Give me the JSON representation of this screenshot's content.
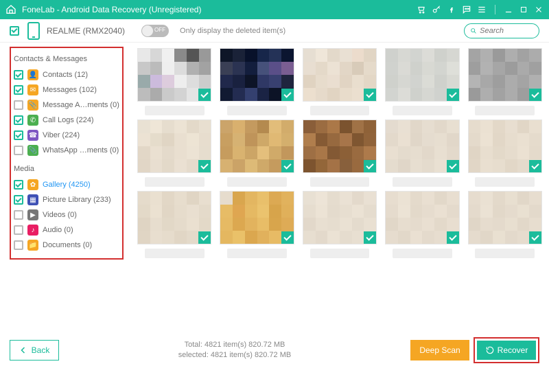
{
  "titlebar": {
    "title": "FoneLab - Android Data Recovery (Unregistered)"
  },
  "toolbar": {
    "device": "REALME (RMX2040)",
    "toggle": "OFF",
    "only_deleted": "Only display the deleted item(s)",
    "search_placeholder": "Search"
  },
  "sidebar": {
    "group1": "Contacts & Messages",
    "group2": "Media",
    "items": [
      {
        "label": "Contacts (12)",
        "checked": true,
        "color": "#f5a623",
        "glyph": "👤"
      },
      {
        "label": "Messages (102)",
        "checked": true,
        "color": "#f5a623",
        "glyph": "✉"
      },
      {
        "label": "Message A…ments (0)",
        "checked": false,
        "color": "#f5a623",
        "glyph": "📎"
      },
      {
        "label": "Call Logs (224)",
        "checked": true,
        "color": "#4caf50",
        "glyph": "✆"
      },
      {
        "label": "Viber (224)",
        "checked": true,
        "color": "#7e57c2",
        "glyph": "☎"
      },
      {
        "label": "WhatsApp …ments (0)",
        "checked": false,
        "color": "#4caf50",
        "glyph": "📎"
      },
      {
        "label": "Gallery (4250)",
        "checked": true,
        "color": "#f5a623",
        "glyph": "✿",
        "selected": true
      },
      {
        "label": "Picture Library (233)",
        "checked": true,
        "color": "#3f51b5",
        "glyph": "▦"
      },
      {
        "label": "Videos (0)",
        "checked": false,
        "color": "#777",
        "glyph": "▶"
      },
      {
        "label": "Audio (0)",
        "checked": false,
        "color": "#e91e63",
        "glyph": "♪"
      },
      {
        "label": "Documents (0)",
        "checked": false,
        "color": "#f5a623",
        "glyph": "📁"
      }
    ]
  },
  "thumbs": {
    "rows": 3,
    "cols": 5,
    "patterns": [
      [
        "#e8e8e8",
        "#d7d7d7",
        "#f0f0f0",
        "#8a8a8a",
        "#555",
        "#999",
        "#c8c8c8",
        "#bbb",
        "#efefef",
        "#dcdcdc",
        "#b0b0b0",
        "#a2a2a2",
        "#9aa",
        "#cbd",
        "#dcd",
        "#eee",
        "#ddd",
        "#ccc",
        "#bcbcbc",
        "#ababab",
        "#cacaca",
        "#d3d3d3",
        "#e4e4e4",
        "#d1d1d1"
      ],
      [
        "#0e1628",
        "#1a2238",
        "#08112a",
        "#17264a",
        "#243257",
        "#0b1530",
        "#3a3f55",
        "#2b3352",
        "#131e3d",
        "#46517a",
        "#5a4f88",
        "#7a5e92",
        "#20284b",
        "#19213f",
        "#0d1427",
        "#2f3865",
        "#384070",
        "#1f253e",
        "#111a32",
        "#232c51",
        "#34406f",
        "#1a2344",
        "#0c1326",
        "#151d36"
      ],
      [
        "#e6ded2",
        "#efe6d9",
        "#e3d9ca",
        "#e9e0d3",
        "#ecdccc",
        "#e1d5c4",
        "#e8ded1",
        "#e4d9c9",
        "#ece2d4",
        "#e2d6c6",
        "#d8cbb9",
        "#e5daca",
        "#e0d3c1",
        "#e7dccc",
        "#eaded0",
        "#e1d4c3",
        "#e9dece",
        "#e3d7c6",
        "#ecdfce",
        "#e6daca",
        "#e1d4c2",
        "#e8dccb",
        "#ebdfcf",
        "#e4d8c7"
      ],
      [
        "#cfd1cd",
        "#d7d8d3",
        "#d2d4d0",
        "#dcdcd7",
        "#cfd1cc",
        "#d6d7d2",
        "#d0d2ce",
        "#dadad5",
        "#cfd1cc",
        "#d8d9d3",
        "#d3d5d0",
        "#dedfd9",
        "#cfd1cc",
        "#d6d7d2",
        "#d1d3cf",
        "#dbdcD6",
        "#cfd1cc",
        "#d8d9d3",
        "#d2d4d0",
        "#dcdcd7",
        "#cfd1cc",
        "#d6d7d2",
        "#d0d2ce",
        "#dadad5"
      ],
      [
        "#a4a4a4",
        "#b0b0b0",
        "#9a9a9a",
        "#aeaeae",
        "#a2a2a2",
        "#acacac",
        "#9e9e9e",
        "#b2b2b2",
        "#a6a6a6",
        "#9c9c9c",
        "#aaaaaa",
        "#a0a0a0",
        "#b4b4b4",
        "#a8a8a8",
        "#9e9e9e",
        "#acacac",
        "#a4a4a4",
        "#b0b0b0",
        "#9a9a9a",
        "#aeaeae",
        "#a2a2a2",
        "#acacac",
        "#9e9e9e",
        "#b2b2b2"
      ],
      [
        "#e9e1d3",
        "#efe6d7",
        "#e6ddce",
        "#ece3d4",
        "#e3d9c9",
        "#e8dfd0",
        "#ece2d3",
        "#e5dccb",
        "#e0d5c4",
        "#e9dfd0",
        "#ede4d4",
        "#e7ddce",
        "#e2d7c7",
        "#eae0d1",
        "#e4dacb",
        "#e9dfd0",
        "#ece3d4",
        "#e6ddce",
        "#e1d6c6",
        "#e8ded0",
        "#e3d9c9",
        "#eae0d2",
        "#e5dbcc",
        "#e9dfd0"
      ],
      [
        "#cba46a",
        "#d9b06e",
        "#c49a5f",
        "#b48a4f",
        "#e2bd7a",
        "#d2ac6b",
        "#c89f61",
        "#d6b273",
        "#bf945a",
        "#cea868",
        "#e0b974",
        "#d4af6d",
        "#c69c5e",
        "#d9b370",
        "#cca566",
        "#e4bf7c",
        "#d0aa69",
        "#c2975c",
        "#d7b171",
        "#cba367",
        "#ddba77",
        "#cfa969",
        "#c59b5e",
        "#d3ae6c"
      ],
      [
        "#8a5e39",
        "#9b6c41",
        "#ab7848",
        "#7b532f",
        "#a07246",
        "#8f6238",
        "#b07e4d",
        "#855a34",
        "#97693f",
        "#a7754a",
        "#7f5631",
        "#90633a",
        "#9e6f44",
        "#a97748",
        "#835934",
        "#8c6037",
        "#9a6b40",
        "#ad7a4b",
        "#7d542f",
        "#936639",
        "#a47246",
        "#88603c",
        "#996a3f",
        "#a57447"
      ],
      [
        "#e4dbcf",
        "#e9e0d3",
        "#e1d7c9",
        "#e6ddd0",
        "#e2d8ca",
        "#e8dfd1",
        "#e3d9cb",
        "#eae0d2",
        "#e0d6c8",
        "#e5dccf",
        "#e7ded0",
        "#e1d7c9",
        "#e9dfd1",
        "#e4dbcd",
        "#e6ddcf",
        "#e2d8ca",
        "#e8dfd1",
        "#e3d9cb",
        "#e5dcce",
        "#e0d6c8",
        "#e7ded0",
        "#e4dbcd",
        "#e9e0d2",
        "#e1d7c9"
      ],
      [
        "#e6dccd",
        "#ebe1d2",
        "#e3d8c8",
        "#e8ded0",
        "#e1d6c6",
        "#e9dfd0",
        "#e4dacb",
        "#ece2d3",
        "#e2d7c7",
        "#e7ddce",
        "#eae0d1",
        "#e5dbcc",
        "#e0d5c5",
        "#e8decf",
        "#e3d9c9",
        "#e6dccd",
        "#ebe1d2",
        "#e4dacb",
        "#e1d6c6",
        "#e9dfd0",
        "#e7ddce",
        "#e2d7c7",
        "#e5dbcc",
        "#e8decf"
      ],
      [
        "#e5dbcb",
        "#eae0d0",
        "#e2d7c6",
        "#e7ddcd",
        "#e0d5c4",
        "#e8decf",
        "#e3d9c8",
        "#ebe1d1",
        "#e1d6c5",
        "#e6dccc",
        "#e9dfd0",
        "#e4daca",
        "#dfd4c3",
        "#e7ddce",
        "#e2d8c7",
        "#e5dbcb",
        "#eae0d0",
        "#e3d9c8",
        "#e0d5c4",
        "#e8decf",
        "#e6dccc",
        "#e1d6c5",
        "#e4daca",
        "#e7ddce"
      ],
      [
        "#e6dccd",
        "#d9a64e",
        "#e3b661",
        "#e9c06b",
        "#dca953",
        "#e1b25d",
        "#e7bc66",
        "#dfa651",
        "#e5b963",
        "#ebc36e",
        "#d7a44b",
        "#e0b05a",
        "#e6ba64",
        "#dca850",
        "#e2b35e",
        "#e8bd67",
        "#d8a54c",
        "#deab56",
        "#e4b760",
        "#eac169",
        "#dba74f",
        "#e1b15c",
        "#e7bb65",
        "#ddaa54"
      ],
      [
        "#e8e0d3",
        "#ede4d7",
        "#e5dcce",
        "#eae1d4",
        "#e3d9cb",
        "#e9e0d3",
        "#e6ddcf",
        "#ece3d5",
        "#e4dbcd",
        "#e7ded0",
        "#ebe2d4",
        "#e5dcce",
        "#e2d8ca",
        "#e8dfd1",
        "#e6ddcf",
        "#eae1d3",
        "#e4dbcd",
        "#e9e0d2",
        "#e7ded0",
        "#e3d9cb",
        "#ebe2d4",
        "#e5dcce",
        "#e8dfd1",
        "#e6ddcf"
      ],
      [
        "#e7ddcf",
        "#ebe2d4",
        "#e4dacb",
        "#e9dfd1",
        "#e2d8c9",
        "#e8ded0",
        "#e5dbcd",
        "#ece3d5",
        "#e3d9ca",
        "#e6dcce",
        "#eae0d2",
        "#e4dacc",
        "#e1d7c8",
        "#e7ddcf",
        "#e5dbcd",
        "#e9dfd1",
        "#e3d9ca",
        "#e8ded0",
        "#e6dcce",
        "#e2d8c9",
        "#eae0d2",
        "#e4dacc",
        "#e7ddcf",
        "#e5dbcd"
      ],
      [
        "#e6dcce",
        "#eae1d3",
        "#e3d9ca",
        "#e8dfd0",
        "#e1d7c8",
        "#e7ddcf",
        "#e4dacc",
        "#ebe2d4",
        "#e2d8c9",
        "#e5dbcd",
        "#e9e0d1",
        "#e3d9cb",
        "#e0d6c7",
        "#e6dcce",
        "#e4dacc",
        "#e8dfd0",
        "#e2d8c9",
        "#e7ddcf",
        "#e5dbcd",
        "#e1d7c8",
        "#e9e0d1",
        "#e3d9cb",
        "#e6dcce",
        "#e4dacc"
      ]
    ]
  },
  "bottom": {
    "back": "Back",
    "total": "Total: 4821 item(s) 820.72 MB",
    "selected": "selected: 4821 item(s) 820.72 MB",
    "deep": "Deep Scan",
    "recover": "Recover"
  }
}
